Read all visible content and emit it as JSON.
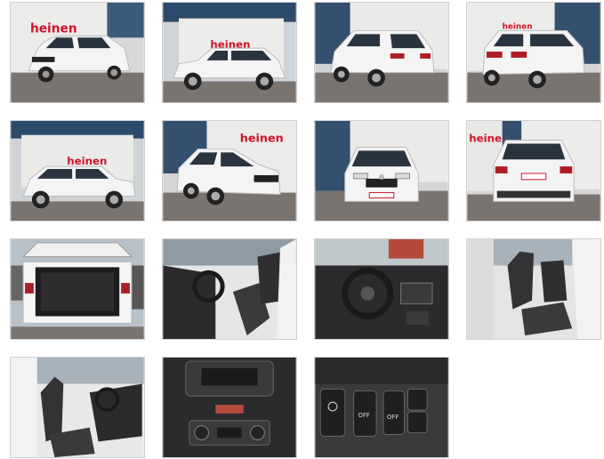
{
  "gallery": {
    "brand_text": "heinen",
    "photos": [
      {
        "label": "front-left exterior"
      },
      {
        "label": "left side exterior"
      },
      {
        "label": "rear-left exterior"
      },
      {
        "label": "rear-right exterior"
      },
      {
        "label": "right side exterior"
      },
      {
        "label": "front-right exterior"
      },
      {
        "label": "front exterior"
      },
      {
        "label": "rear exterior"
      },
      {
        "label": "open trunk"
      },
      {
        "label": "driver seat interior"
      },
      {
        "label": "dashboard"
      },
      {
        "label": "rear seats"
      },
      {
        "label": "front seats"
      },
      {
        "label": "center console"
      },
      {
        "label": "switch panel"
      }
    ],
    "switch_labels": {
      "off1": "OFF",
      "off2": "OFF"
    },
    "colors": {
      "car_white": "#f4f4f4",
      "brand_red": "#d0142a",
      "ground": "#7a7470",
      "interior": "#2b2b2d"
    }
  }
}
